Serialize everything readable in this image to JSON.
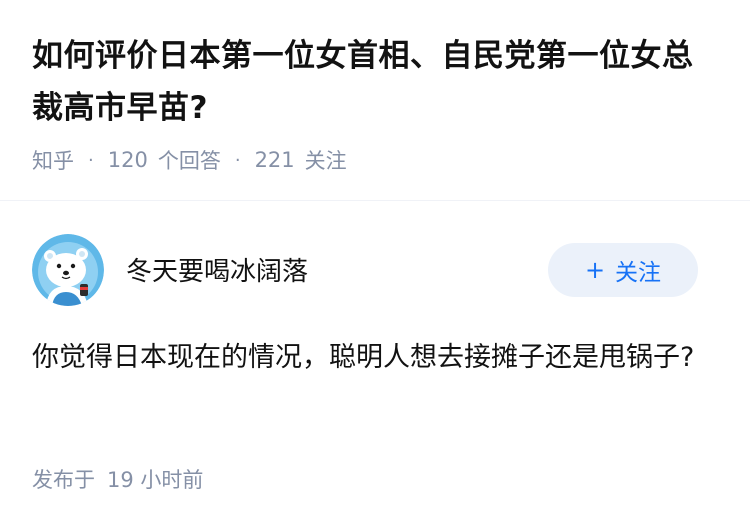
{
  "question": {
    "title": "如何评价日本第一位女首相、自民党第一位女总裁高市早苗?",
    "source": "知乎",
    "answer_count": "120",
    "answer_label": "个回答",
    "follower_count": "221",
    "follower_label": "关注"
  },
  "author": {
    "name": "冬天要喝冰阔落",
    "avatar_icon": "polar-bear-avatar",
    "follow_label": "关注"
  },
  "answer": {
    "content": "你觉得日本现在的情况，聪明人想去接摊子还是甩锅子?",
    "published_label": "发布于",
    "published_time": "19 小时前"
  },
  "colors": {
    "accent": "#1772f6",
    "button_bg": "#ebf1fa",
    "meta_gray": "#8590a6"
  }
}
